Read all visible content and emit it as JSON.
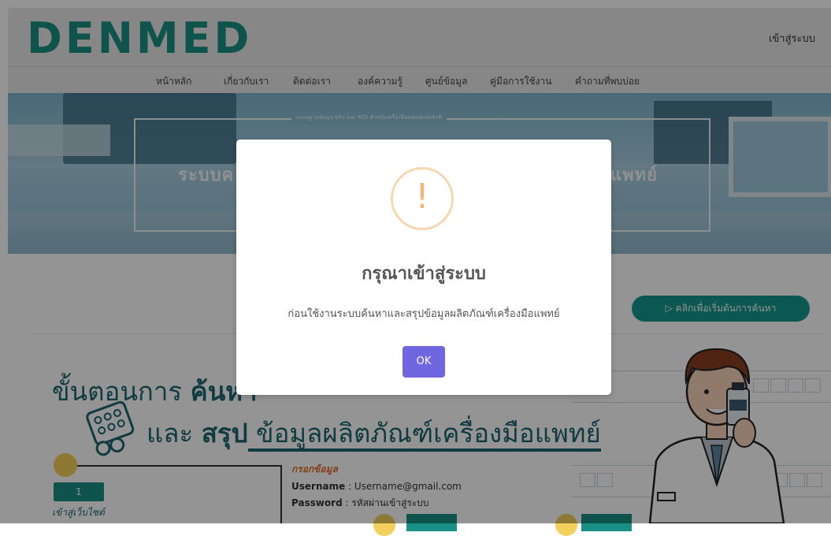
{
  "header": {
    "logo": "DENMED",
    "login_link": "เข้าสู่ระบบ"
  },
  "nav": {
    "items": [
      "หน้าหลัก",
      "เกี่ยวกับเรา",
      "ติดต่อเรา",
      "องค์ความรู้",
      "ศูนย์ข้อมูล",
      "คู่มือการใช้งาน",
      "คำถามที่พบบ่อย"
    ]
  },
  "banner": {
    "tagline": "ระบบฐานข้อมูล EPs และ NQI สำหรับเครื่องมือแพทย์แห่งชาติ",
    "title_left": "ระบบค",
    "title_right": "แพทย์"
  },
  "main": {
    "start_button": "▷ คลิกเพื่อเริ่มต้นการค้นหา",
    "steps_title_line1_prefix": "ขั้นตอนการ ",
    "steps_title_line1_bold": "ค้นหา",
    "steps_title_line2_prefix": "และ ",
    "steps_title_line2_bold": "สรุป",
    "steps_title_line2_rest": " ข้อมูลผลิตภัณฑ์เครื่องมือแพทย์",
    "step1_number": "1",
    "step1_label": "เข้าสู่เว็บไซต์",
    "fill_title": "กรอกข้อมูล",
    "username_label": "Username",
    "username_value": ": Username@gmail.com",
    "password_label": "Password",
    "password_value": ":  รหัสผ่านเข้าสู่ระบบ"
  },
  "modal": {
    "icon": "!",
    "title": "กรุณาเข้าสู่ระบบ",
    "text": "ก่อนใช้งานระบบค้นหาและสรุปข้อมูลผลิตภัณฑ์เครื่องมือแพทย์",
    "ok_label": "OK"
  },
  "colors": {
    "brand": "#1a8f86",
    "ok_button": "#7066e0",
    "warning": "#f4b57d"
  }
}
